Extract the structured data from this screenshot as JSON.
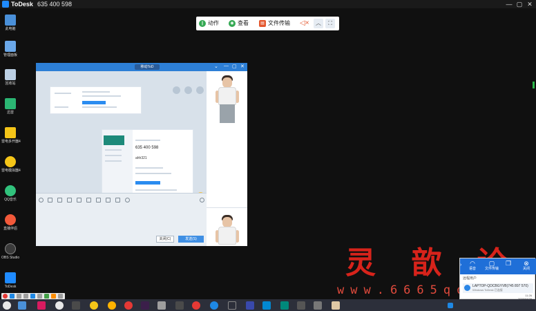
{
  "titlebar": {
    "brand": "ToDesk",
    "device_code": "635 400 598",
    "minimize": "—",
    "maximize": "▢",
    "close": "✕"
  },
  "toolbar": {
    "action_label": "动作",
    "view_label": "查看",
    "file_transfer_label": "文件传输",
    "mute_icon": "speaker-muted-icon",
    "collapse_icon": "chevron-up-icon",
    "fullscreen_icon": "fullscreen-icon"
  },
  "desktop_icons": [
    {
      "label": "此电脑",
      "color": "#4a90d9"
    },
    {
      "label": "管理面板",
      "color": "#6aa7e8"
    },
    {
      "label": "回收站",
      "color": "#bcd0e4"
    },
    {
      "label": "迅雷",
      "color": "#2bb673"
    },
    {
      "label": "雷电多开器4",
      "color": "#f5c518"
    },
    {
      "label": "雷电模拟器4",
      "color": "#f5c518"
    },
    {
      "label": "QQ音乐",
      "color": "#31c27c"
    },
    {
      "label": "直播伴侣",
      "color": "#f2593a"
    },
    {
      "label": "OBS Studio",
      "color": "#3b3b3b"
    },
    {
      "label": "ToDesk",
      "color": "#1f8bff"
    }
  ],
  "remote_window": {
    "title_badge": "移动ToD",
    "close_button": "关闭(C)",
    "send_button": "发送(S)"
  },
  "embedded_todesk": {
    "device_code": "635 400 598",
    "password": "ahh321"
  },
  "watermark": {
    "chinese": "灵 歆 论 坛",
    "url": "www.6665qq.com"
  },
  "popup": {
    "buttons": [
      "语音",
      "文件传输",
      "关闭"
    ],
    "subtitle": "远程用户",
    "device_name": "LAPTOP-QDCBGYVB(745 897 570)",
    "device_sub": "Windows ToDesk 已连接",
    "time": "11:26",
    "date": "2026/04/29"
  }
}
